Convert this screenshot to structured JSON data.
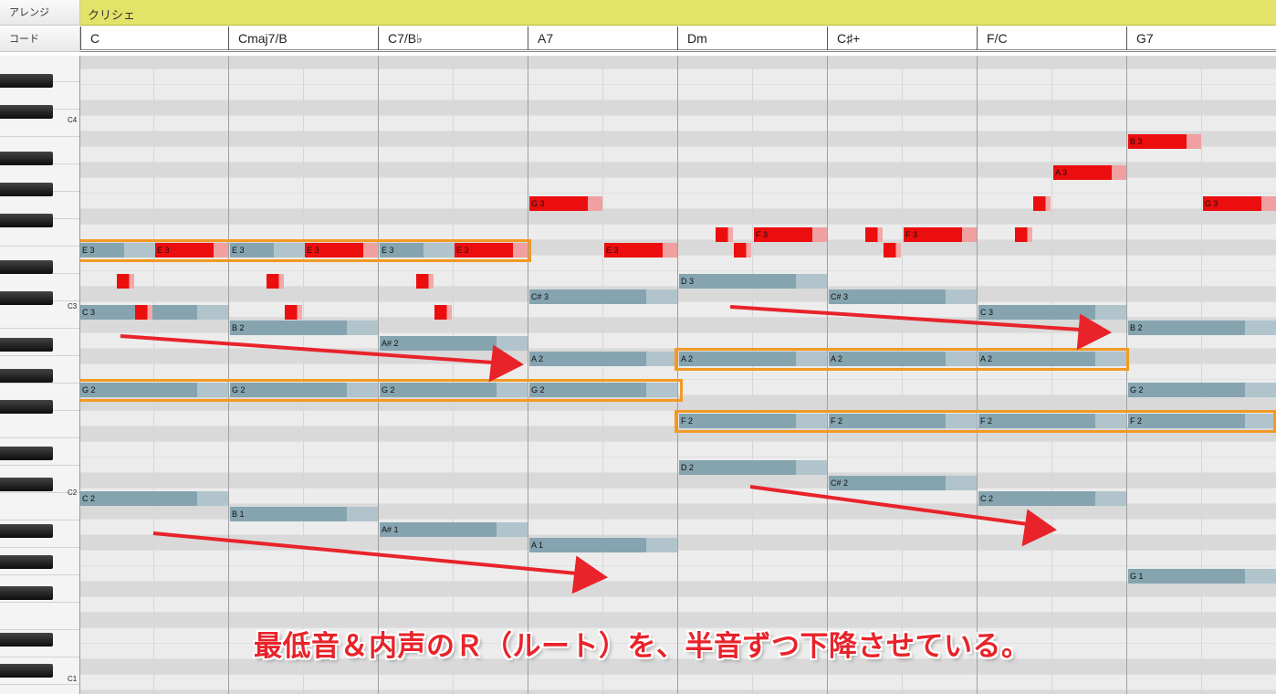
{
  "header": {
    "arrange_label": "アレンジ",
    "chord_label": "コード",
    "arrange_name": "クリシェ"
  },
  "chords": [
    "C",
    "Cmaj7/B",
    "C7/B♭",
    "A7",
    "Dm",
    "C♯+",
    "F/C",
    "G7"
  ],
  "keyboard": {
    "c_labels": [
      "C4",
      "C3",
      "C2",
      "C1"
    ]
  },
  "notes": {
    "bass": [
      {
        "label": "C 2",
        "pitch": "C2",
        "bar": 0
      },
      {
        "label": "B 1",
        "pitch": "B1",
        "bar": 1
      },
      {
        "label": "A# 1",
        "pitch": "A#1",
        "bar": 2
      },
      {
        "label": "A 1",
        "pitch": "A1",
        "bar": 3
      },
      {
        "label": "D 2",
        "pitch": "D2",
        "bar": 4
      },
      {
        "label": "C# 2",
        "pitch": "C#2",
        "bar": 5
      },
      {
        "label": "C 2",
        "pitch": "C2",
        "bar": 6
      },
      {
        "label": "G 1",
        "pitch": "G1",
        "bar": 7
      }
    ],
    "inner": [
      {
        "label": "G 2",
        "pitch": "G2",
        "bar": 0
      },
      {
        "label": "G 2",
        "pitch": "G2",
        "bar": 1
      },
      {
        "label": "G 2",
        "pitch": "G2",
        "bar": 2
      },
      {
        "label": "G 2",
        "pitch": "G2",
        "bar": 3
      },
      {
        "label": "B 2",
        "pitch": "B2",
        "bar": 1
      },
      {
        "label": "A# 2",
        "pitch": "A#2",
        "bar": 2
      },
      {
        "label": "A 2",
        "pitch": "A2",
        "bar": 3
      },
      {
        "label": "A 2",
        "pitch": "A2",
        "bar": 4
      },
      {
        "label": "A 2",
        "pitch": "A2",
        "bar": 5
      },
      {
        "label": "A 2",
        "pitch": "A2",
        "bar": 6
      },
      {
        "label": "F 2",
        "pitch": "F2",
        "bar": 4
      },
      {
        "label": "F 2",
        "pitch": "F2",
        "bar": 5
      },
      {
        "label": "F 2",
        "pitch": "F2",
        "bar": 6
      },
      {
        "label": "F 2",
        "pitch": "F2",
        "bar": 7
      },
      {
        "label": "C 3",
        "pitch": "C3",
        "bar": 0
      },
      {
        "label": "E 3",
        "pitch": "E3",
        "bar": 0
      },
      {
        "label": "E 3",
        "pitch": "E3",
        "bar": 1
      },
      {
        "label": "E 3",
        "pitch": "E3",
        "bar": 2
      },
      {
        "label": "C# 3",
        "pitch": "C#3",
        "bar": 3
      },
      {
        "label": "D 3",
        "pitch": "D3",
        "bar": 4
      },
      {
        "label": "C# 3",
        "pitch": "C#3",
        "bar": 5
      },
      {
        "label": "C 3",
        "pitch": "C3",
        "bar": 6
      },
      {
        "label": "B 2",
        "pitch": "B2",
        "bar": 7
      },
      {
        "label": "G 2",
        "pitch": "G2",
        "bar": 7
      }
    ],
    "melody": [
      {
        "label": "E 3",
        "pitch": "E3"
      },
      {
        "label": "E 3",
        "pitch": "E3"
      },
      {
        "label": "E 3",
        "pitch": "E3"
      },
      {
        "label": "E 3",
        "pitch": "E3"
      },
      {
        "label": "G 3",
        "pitch": "G3"
      },
      {
        "label": "F 3",
        "pitch": "F3"
      },
      {
        "label": "F 3",
        "pitch": "F3"
      },
      {
        "label": "A 3",
        "pitch": "A3"
      },
      {
        "label": "B 3",
        "pitch": "B3"
      },
      {
        "label": "G 3",
        "pitch": "G3"
      },
      {
        "label": "",
        "pitch": "D#3"
      },
      {
        "label": "",
        "pitch": "C#3"
      }
    ]
  },
  "annotation": "最低音＆内声のＲ（ルート）を、半音ずつ下降させている。",
  "colors": {
    "arrange_bar": "#e3e36a",
    "note_blue": "#85a4b0",
    "note_red": "#ec0e0e",
    "highlight": "#f29a24",
    "arrow": "#e8232a"
  }
}
